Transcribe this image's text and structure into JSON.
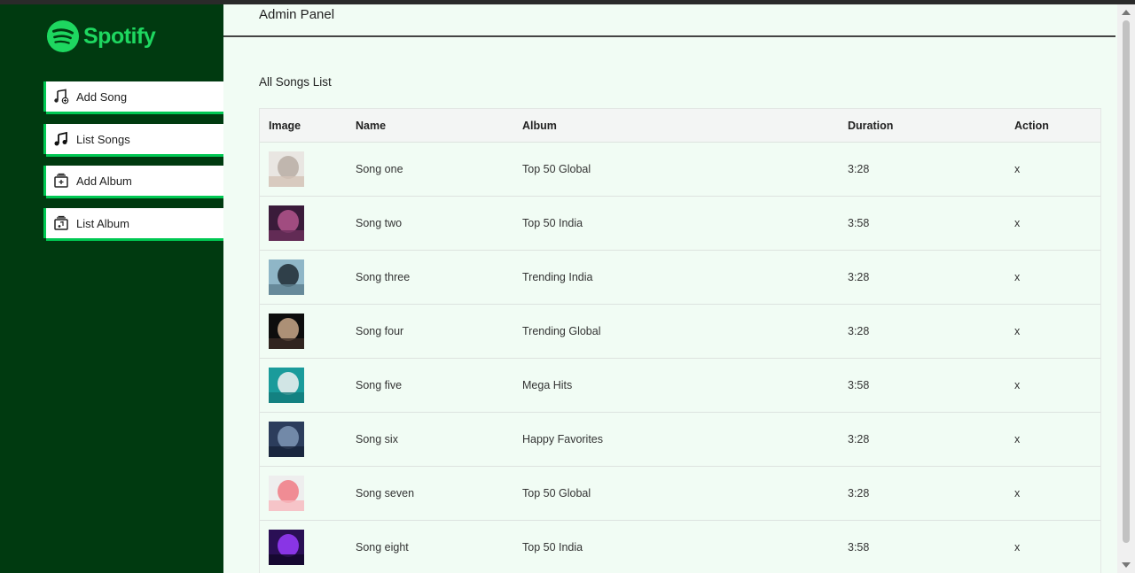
{
  "brand": {
    "name": "Spotify",
    "color": "#1ed760"
  },
  "sidebar": {
    "items": [
      {
        "label": "Add Song",
        "icon": "music-note-plus-icon"
      },
      {
        "label": "List Songs",
        "icon": "music-note-icon"
      },
      {
        "label": "Add Album",
        "icon": "album-add-icon"
      },
      {
        "label": "List Album",
        "icon": "album-list-icon"
      }
    ]
  },
  "header": {
    "title": "Admin Panel"
  },
  "main": {
    "section_title": "All Songs List",
    "columns": [
      "Image",
      "Name",
      "Album",
      "Duration",
      "Action"
    ],
    "rows": [
      {
        "name": "Song one",
        "album": "Top 50 Global",
        "duration": "3:28",
        "action": "x",
        "art": [
          "#e9e6e2",
          "#b9ada4",
          "#d3c3b6"
        ]
      },
      {
        "name": "Song two",
        "album": "Top 50 India",
        "duration": "3:58",
        "action": "x",
        "art": [
          "#3a1b3a",
          "#b4558d",
          "#6d2f5c"
        ]
      },
      {
        "name": "Song three",
        "album": "Trending India",
        "duration": "3:28",
        "action": "x",
        "art": [
          "#8fb6c7",
          "#1f2a33",
          "#5c7f8f"
        ]
      },
      {
        "name": "Song four",
        "album": "Trending Global",
        "duration": "3:28",
        "action": "x",
        "art": [
          "#0d0d0d",
          "#c9a88a",
          "#3a2b24"
        ]
      },
      {
        "name": "Song five",
        "album": "Mega Hits",
        "duration": "3:58",
        "action": "x",
        "art": [
          "#1a9b9b",
          "#f2f2f2",
          "#117a7a"
        ]
      },
      {
        "name": "Song six",
        "album": "Happy Favorites",
        "duration": "3:28",
        "action": "x",
        "art": [
          "#2c3d5c",
          "#7f96b5",
          "#172238"
        ]
      },
      {
        "name": "Song seven",
        "album": "Top 50 Global",
        "duration": "3:28",
        "action": "x",
        "art": [
          "#eeeeee",
          "#f07a84",
          "#f7b9be"
        ]
      },
      {
        "name": "Song eight",
        "album": "Top 50 India",
        "duration": "3:58",
        "action": "x",
        "art": [
          "#2a0f55",
          "#9a3cff",
          "#120628"
        ]
      }
    ]
  }
}
